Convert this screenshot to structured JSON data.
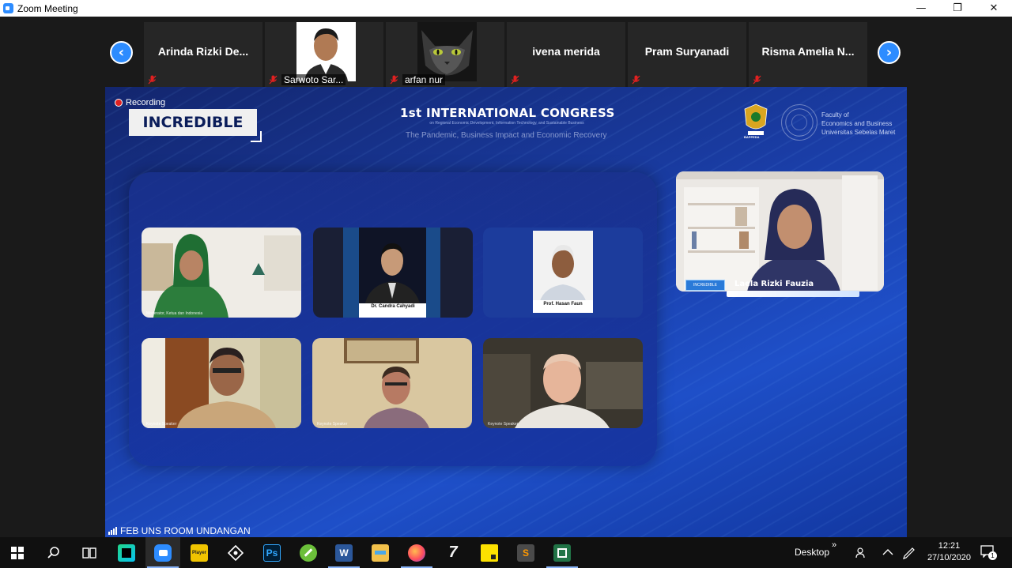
{
  "window": {
    "title": "Zoom Meeting",
    "minimize_glyph": "—",
    "restore_glyph": "❐",
    "close_glyph": "✕"
  },
  "participants": {
    "prev_glyph": "‹",
    "next_glyph": "›",
    "tiles": [
      {
        "name": "Arinda  Rizki  De...",
        "has_video": false
      },
      {
        "name": "Sarwoto  Sar...",
        "has_video": true
      },
      {
        "name": "arfan nur",
        "has_video": true
      },
      {
        "name": "ivena merida",
        "has_video": false
      },
      {
        "name": "Pram Suryanadi",
        "has_video": false
      },
      {
        "name": "Risma Amelia N...",
        "has_video": false
      }
    ]
  },
  "main_video": {
    "recording_label": "Recording",
    "brand": "INCREDIBLE",
    "congress_title": "1st INTERNATIONAL CONGRESS",
    "congress_subtitle": "on Regional Economic Development, Information Technology, and Sustainable Business",
    "congress_theme": "The Pandemic, Business Impact and Economic Recovery",
    "bappeda_label": "BAPPEDA",
    "faculty_line1": "Faculty of",
    "faculty_line2": "Economics and Business",
    "faculty_line3": "Universitas Sebelas Maret",
    "speakers": [
      {
        "caption": "Moderator, Ketua dan Indonesia"
      },
      {
        "caption": "Dr. Candra Cahyadi"
      },
      {
        "caption": "Prof. Hasan Faun"
      },
      {
        "caption": "Keynote Speaker"
      },
      {
        "caption": "Keynote Speaker"
      },
      {
        "caption": "Keynote Speaker"
      }
    ],
    "host_name": "Laela Rizki Fauzia",
    "host_logo": "INCREDIBLE"
  },
  "room_label": "FEB UNS ROOM UNDANGAN",
  "taskbar": {
    "apps": [
      {
        "name": "start",
        "label": ""
      },
      {
        "name": "search",
        "label": ""
      },
      {
        "name": "task-view",
        "label": ""
      },
      {
        "name": "pycharm",
        "label": ""
      },
      {
        "name": "zoom",
        "label": ""
      },
      {
        "name": "kmplayer",
        "label": "Player"
      },
      {
        "name": "git",
        "label": ""
      },
      {
        "name": "photoshop",
        "label": "Ps"
      },
      {
        "name": "greenshot",
        "label": ""
      },
      {
        "name": "word",
        "label": "W"
      },
      {
        "name": "file-explorer",
        "label": ""
      },
      {
        "name": "firefox",
        "label": ""
      },
      {
        "name": "7zip",
        "label": "7"
      },
      {
        "name": "sticky-notes",
        "label": ""
      },
      {
        "name": "sublime-text",
        "label": "S"
      },
      {
        "name": "excel",
        "label": ""
      }
    ],
    "desktop_label": "Desktop",
    "time": "12:21",
    "date": "27/10/2020",
    "notification_count": "1"
  },
  "colors": {
    "zoom_blue": "#2d8cff",
    "background": "#1a1a1a",
    "mute_red": "#e02020"
  }
}
